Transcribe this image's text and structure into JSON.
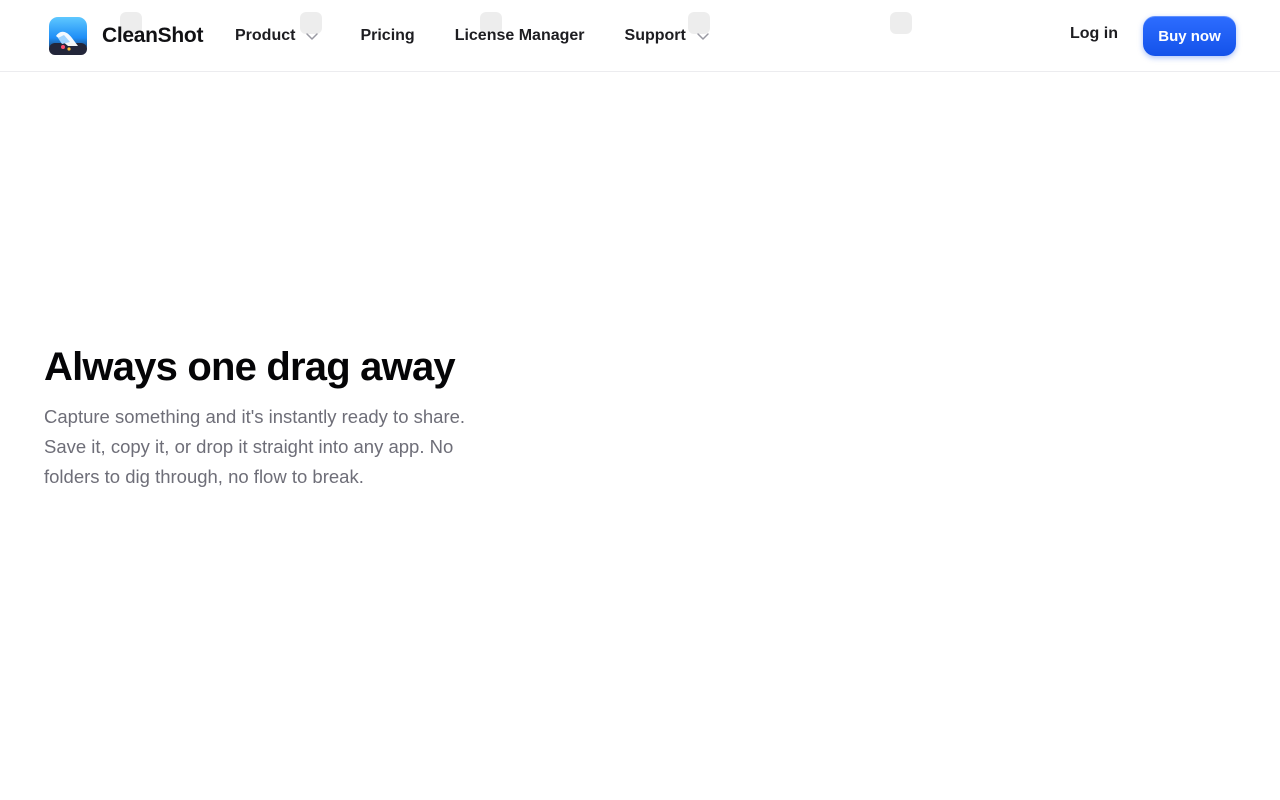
{
  "brand": {
    "name": "CleanShot",
    "colors": {
      "primary": "#1452ea",
      "primary_light": "#2d6dff",
      "text": "#1d1d21",
      "muted": "#6e6e78"
    }
  },
  "nav": {
    "items": [
      {
        "label": "Product",
        "has_dropdown": true,
        "icon": "chevron-down-icon"
      },
      {
        "label": "Pricing",
        "has_dropdown": false
      },
      {
        "label": "License Manager",
        "has_dropdown": false
      },
      {
        "label": "Support",
        "has_dropdown": true,
        "icon": "chevron-down-icon"
      }
    ],
    "login_label": "Log in",
    "buy_label": "Buy now"
  },
  "hero": {
    "title": "Always one drag away",
    "description": "Capture something and it's instantly ready to share. Save it, copy it, or drop it straight into any app. No folders to dig through, no flow to break."
  }
}
